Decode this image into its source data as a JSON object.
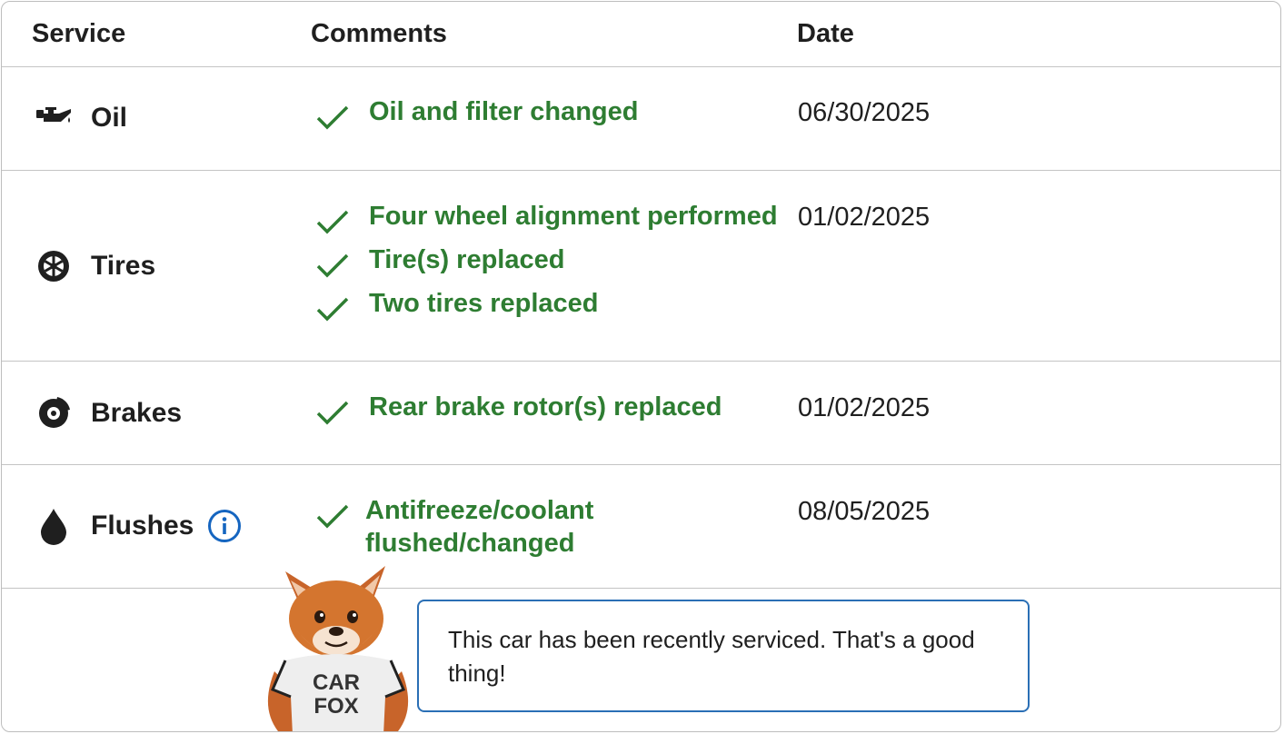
{
  "header": {
    "service": "Service",
    "comments": "Comments",
    "date": "Date"
  },
  "rows": [
    {
      "service": "Oil",
      "icon": "oil-can-icon",
      "comments": [
        "Oil and filter changed"
      ],
      "date": "06/30/2025"
    },
    {
      "service": "Tires",
      "icon": "tire-icon",
      "comments": [
        "Four wheel alignment performed",
        "Tire(s) replaced",
        "Two tires replaced"
      ],
      "date": "01/02/2025"
    },
    {
      "service": "Brakes",
      "icon": "brake-disc-icon",
      "comments": [
        "Rear brake rotor(s) replaced"
      ],
      "date": "01/02/2025"
    },
    {
      "service": "Flushes",
      "icon": "drop-icon",
      "comments": [
        "Antifreeze/coolant flushed/changed"
      ],
      "date": "08/05/2025"
    }
  ],
  "footer": {
    "mascot_icon": "car-fox-mascot",
    "mascot_shirt_line1": "CAR",
    "mascot_shirt_line2": "FOX",
    "message": "This car has been recently serviced. That's a good thing!"
  },
  "colors": {
    "green": "#2e7d32",
    "info_blue": "#1565c0",
    "bubble_border": "#2a6fb5",
    "divider": "#c4c4c4"
  }
}
